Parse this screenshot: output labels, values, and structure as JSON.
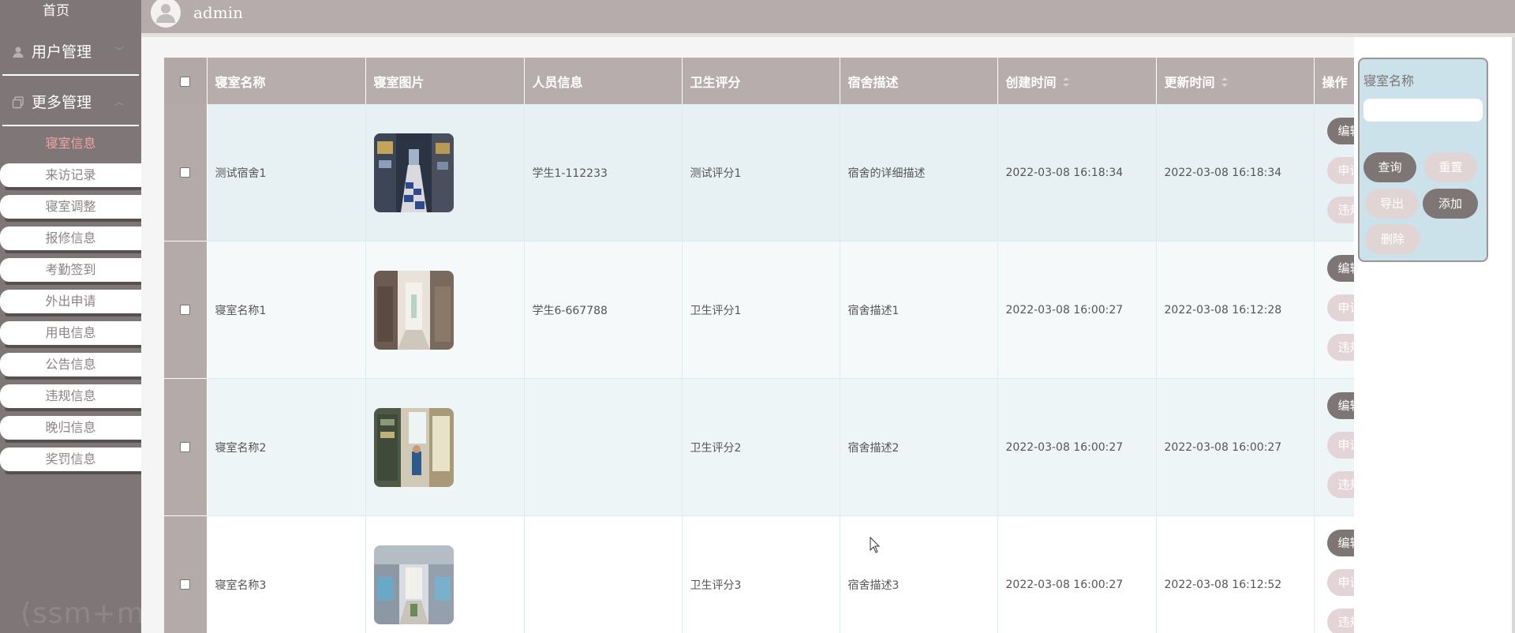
{
  "sidebar": {
    "home": "首页",
    "groups": [
      {
        "label": "用户管理",
        "icon": "user-icon"
      },
      {
        "label": "更多管理",
        "icon": "copy-icon"
      }
    ],
    "active_item": "寝室信息",
    "items": [
      "来访记录",
      "寝室调整",
      "报修信息",
      "考勤签到",
      "外出申请",
      "用电信息",
      "公告信息",
      "违规信息",
      "晚归信息",
      "奖罚信息"
    ],
    "watermark": "(ssm+mysql)校园宿舍管理系统演示录像"
  },
  "header": {
    "username": "admin"
  },
  "table": {
    "columns": [
      "寝室名称",
      "寝室图片",
      "人员信息",
      "卫生评分",
      "宿舍描述",
      "创建时间",
      "更新时间",
      "操作"
    ],
    "rows": [
      {
        "name": "测试宿舍1",
        "people": "学生1-112233",
        "score": "测试评分1",
        "desc": "宿舍的详细描述",
        "created": "2022-03-08 16:18:34",
        "updated": "2022-03-08 16:18:34"
      },
      {
        "name": "寝室名称1",
        "people": "学生6-667788",
        "score": "卫生评分1",
        "desc": "宿舍描述1",
        "created": "2022-03-08 16:00:27",
        "updated": "2022-03-08 16:12:28"
      },
      {
        "name": "寝室名称2",
        "people": "",
        "score": "卫生评分2",
        "desc": "宿舍描述2",
        "created": "2022-03-08 16:00:27",
        "updated": "2022-03-08 16:00:27"
      },
      {
        "name": "寝室名称3",
        "people": "",
        "score": "卫生评分3",
        "desc": "宿舍描述3",
        "created": "2022-03-08 16:00:27",
        "updated": "2022-03-08 16:12:52"
      }
    ],
    "ops": [
      "编辑",
      "申请",
      "违规"
    ]
  },
  "search": {
    "label": "寝室名称",
    "input_value": "",
    "query": "查询",
    "reset": "重置",
    "export": "导出",
    "add": "添加",
    "delete": "删除"
  },
  "colors": {
    "sidebar_bg": "#7f7777",
    "header_bg": "#b6acac",
    "accent": "#f3a3a6",
    "panel_bg": "#cce2eb"
  }
}
